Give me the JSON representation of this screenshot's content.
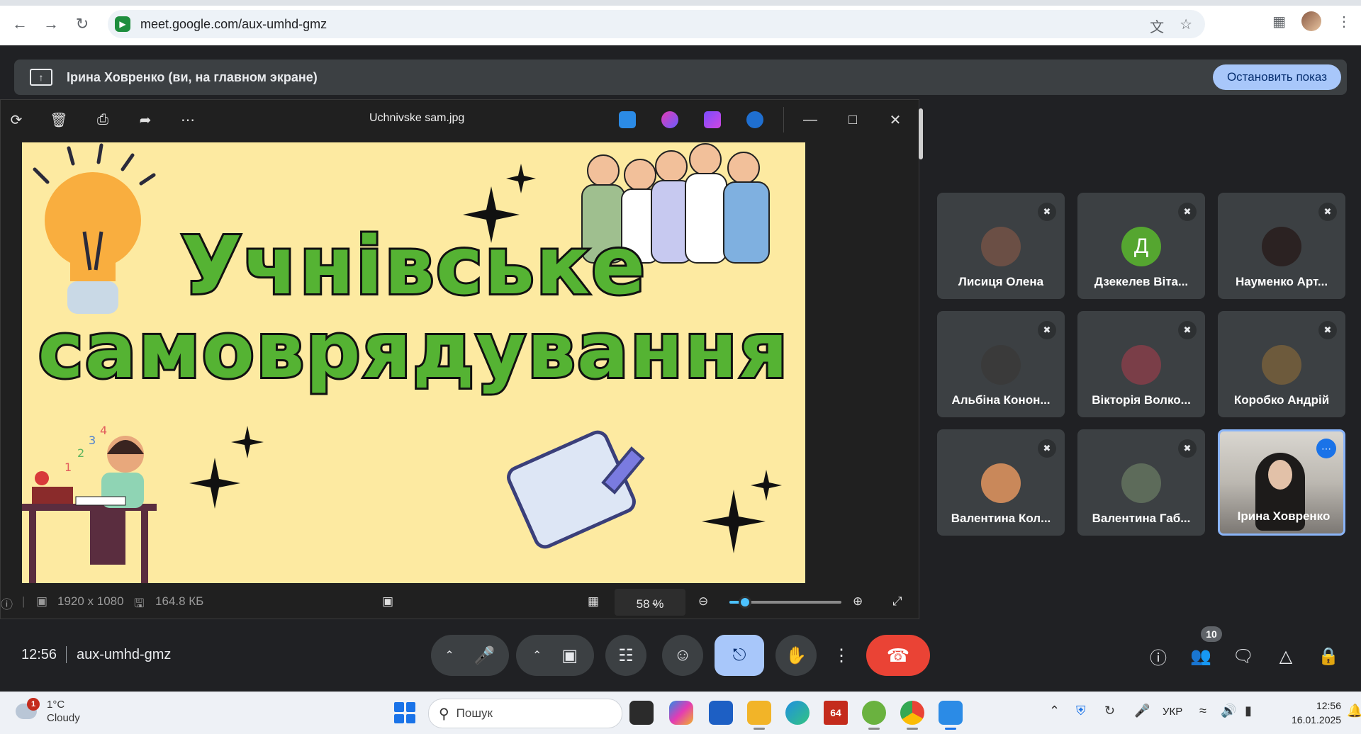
{
  "browser": {
    "url": "meet.google.com/aux-umhd-gmz"
  },
  "banner": {
    "text": "Ірина Ховренко (ви, на главном экране)",
    "stop_label": "Остановить показ"
  },
  "viewer": {
    "title": "Uchnivske sam.jpg",
    "slide_line1": "Учнівське",
    "slide_line2": "самоврядування",
    "dimensions": "1920 x 1080",
    "file_size": "164.8 КБ",
    "zoom": "58 %",
    "zoom_fraction": 0.14
  },
  "participants": [
    {
      "name": "Лисиця Олена",
      "avatar_color": "#6b4f45"
    },
    {
      "name": "Дзекелев Віта...",
      "initial": "Д",
      "avatar_color": "#55a630"
    },
    {
      "name": "Науменко Арт...",
      "avatar_color": "#2b2222"
    },
    {
      "name": "Альбіна Конон...",
      "avatar_color": "#3a3a3a"
    },
    {
      "name": "Вікторія Волко...",
      "avatar_color": "#7a3e48"
    },
    {
      "name": "Коробко Андрій",
      "avatar_color": "#6d5a3c"
    },
    {
      "name": "Валентина Кол...",
      "avatar_color": "#c9885a"
    },
    {
      "name": "Валентина Габ...",
      "avatar_color": "#5d6b5a"
    },
    {
      "name": "Ірина Ховренко"
    }
  ],
  "meeting": {
    "time": "12:56",
    "code": "aux-umhd-gmz",
    "people_count": "10"
  },
  "taskbar": {
    "weather_temp": "1°C",
    "weather_desc": "Cloudy",
    "weather_badge": "1",
    "search_placeholder": "Пошук",
    "lang": "УКР",
    "time": "12:56",
    "date": "16.01.2025",
    "app_64_label": "64"
  }
}
